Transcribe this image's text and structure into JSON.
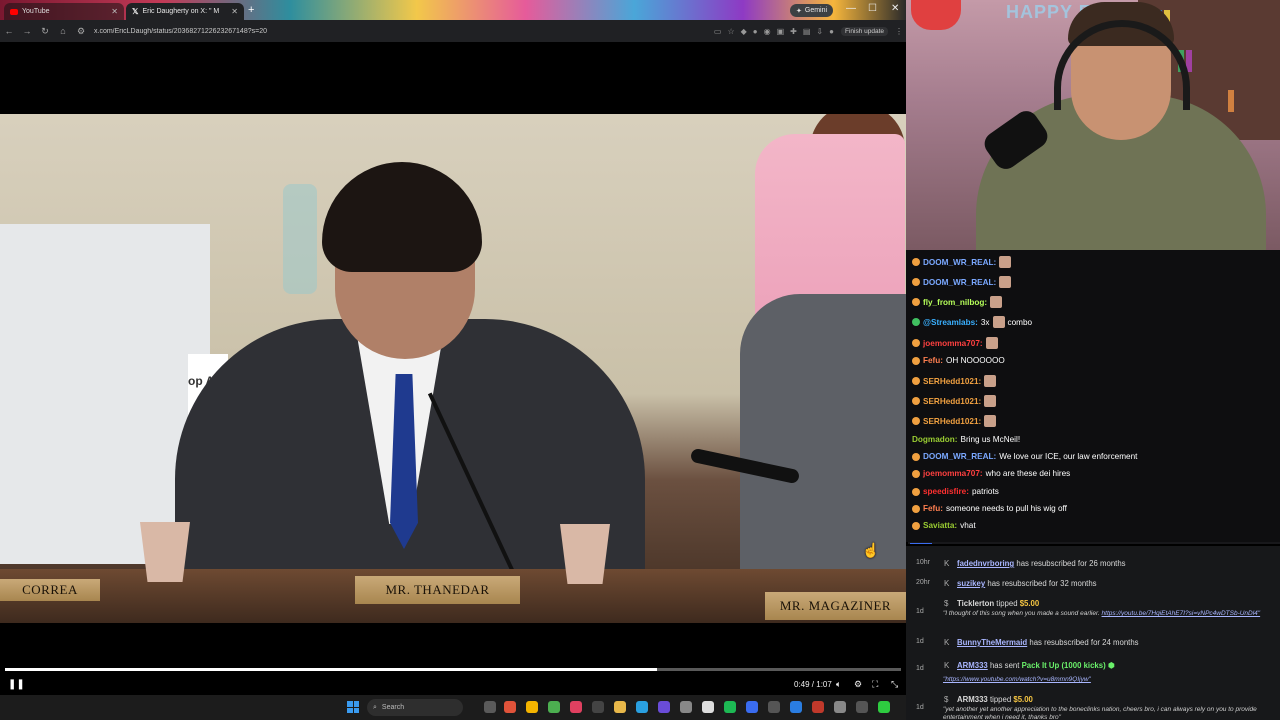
{
  "browser": {
    "tabs": [
      {
        "label": "YouTube",
        "active": false
      },
      {
        "label": "Eric Daugherty on X: \" M",
        "active": true
      }
    ],
    "new_tab": "+",
    "gemini_label": "Gemini",
    "url": "x.com/EricLDaugh/status/2036827122623267148?s=20",
    "finish_update": "Finish update"
  },
  "video": {
    "placards": [
      "CORREA",
      "MR. THANEDAR",
      "MR. MAGAZINER"
    ],
    "background_sign": "op Ai",
    "time": "0:49 / 1:07",
    "progress_fraction": 0.728
  },
  "taskbar": {
    "search_placeholder": "Search"
  },
  "webcam": {
    "banner": "HAPPY EASTER"
  },
  "chat": {
    "messages": [
      {
        "user": "DOOM_WR_REAL:",
        "color": "#7aa8ff",
        "text": "",
        "emote": true
      },
      {
        "user": "DOOM_WR_REAL:",
        "color": "#7aa8ff",
        "text": "",
        "emote": true
      },
      {
        "user": "fly_from_nilbog:",
        "color": "#b6ff5a",
        "text": "",
        "emote": true
      },
      {
        "user": "@Streamlabs:",
        "color": "#3ab0ff",
        "text": "3x",
        "emote": true,
        "suffix": "combo"
      },
      {
        "user": "joemomma707:",
        "color": "#ff4040",
        "text": "",
        "emote": true
      },
      {
        "user": "Fefu:",
        "color": "#ff7f50",
        "text": "OH NOOOOOO"
      },
      {
        "user": "SERHedd1021:",
        "color": "#f0a040",
        "text": "",
        "emote": true
      },
      {
        "user": "SERHedd1021:",
        "color": "#f0a040",
        "text": "",
        "emote": true
      },
      {
        "user": "SERHedd1021:",
        "color": "#f0a040",
        "text": "",
        "emote": true
      },
      {
        "user": "Dogmadon:",
        "color": "#9acd32",
        "text": "Bring us McNeil!"
      },
      {
        "user": "DOOM_WR_REAL:",
        "color": "#7aa8ff",
        "text": "We love our ICE, our law enforcement"
      },
      {
        "user": "joemomma707:",
        "color": "#ff4040",
        "text": "who are these dei hires"
      },
      {
        "user": "speedisfire:",
        "color": "#ff3030",
        "text": "patriots"
      },
      {
        "user": "Fefu:",
        "color": "#ff7f50",
        "text": "someone needs to pull his wig off"
      },
      {
        "user": "Saviatta:",
        "color": "#9acd32",
        "text": "vhat"
      }
    ]
  },
  "feed": {
    "events": [
      {
        "time": "10hr",
        "name": "fadednvrboring",
        "text": "has resubscribed for 26 months"
      },
      {
        "time": "20hr",
        "name": "suzikey",
        "text": "has resubscribed for 32 months"
      },
      {
        "time": "1d",
        "name": "Ticklerton",
        "text": "tipped",
        "amount": "$5.00",
        "message": "\"I thought of this song when you made a sound earlier.",
        "link": "https://youtu.be/7HqiEtAhE7I?si=vNPc4wDTSb-UnDl4\""
      },
      {
        "time": "1d",
        "name": "BunnyTheMermaid",
        "text": "has resubscribed for 24 months"
      },
      {
        "time": "1d",
        "name": "ARM333",
        "text": "has sent",
        "pack": "Pack It Up (1000 kicks)",
        "link": "\"https://www.youtube.com/watch?v=u8mmn9QIjyw\""
      },
      {
        "time": "1d",
        "name": "ARM333",
        "text": "tipped",
        "amount": "$5.00",
        "message": "\"yet another yet another appreciation to the boneclinks nation, cheers bro, i can always rely on you to provide entertainment when i need it, thanks bro\""
      }
    ]
  },
  "colors": {
    "chat_bg": "#0e0e10",
    "feed_bg": "#17181a",
    "accent": "#3a6cf0"
  }
}
